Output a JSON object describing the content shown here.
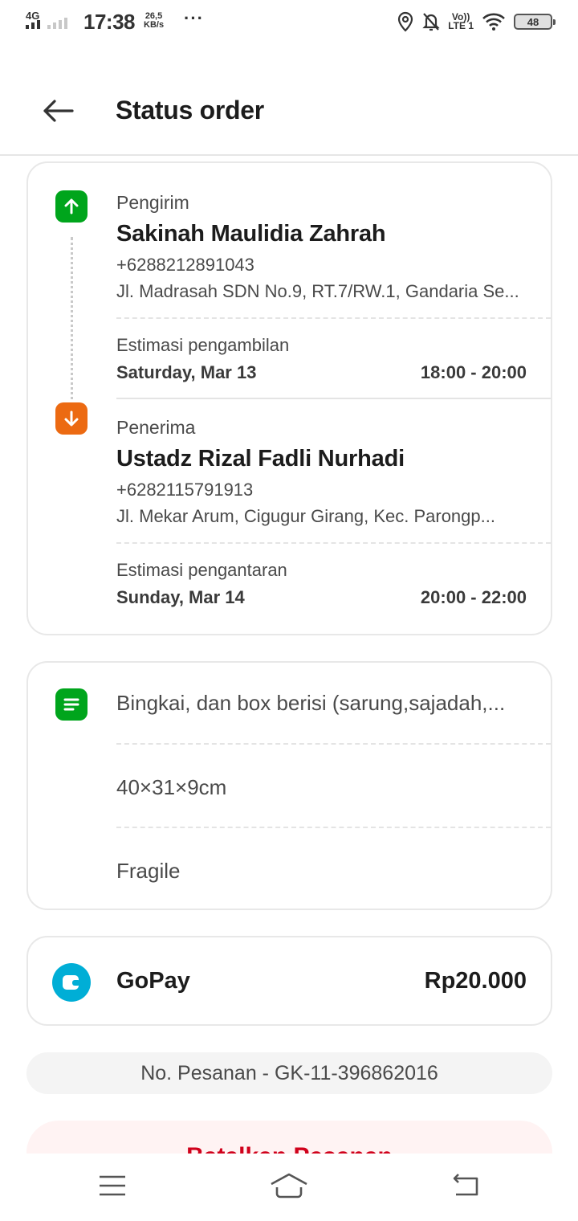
{
  "status_bar": {
    "network": "4G",
    "time": "17:38",
    "speed_value": "26,5",
    "speed_unit": "KB/s",
    "more": "···",
    "volte": "Vo))",
    "lte": "LTE 1",
    "battery": "48"
  },
  "header": {
    "title": "Status order"
  },
  "sender": {
    "label": "Pengirim",
    "name": "Sakinah Maulidia Zahrah",
    "phone": "+6288212891043",
    "address": "Jl. Madrasah SDN No.9, RT.7/RW.1, Gandaria Se...",
    "estimate_label": "Estimasi pengambilan",
    "estimate_date": "Saturday, Mar 13",
    "estimate_time": "18:00 - 20:00"
  },
  "receiver": {
    "label": "Penerima",
    "name": "Ustadz Rizal Fadli Nurhadi",
    "phone": "+6282115791913",
    "address": "Jl. Mekar Arum, Cigugur Girang, Kec. Parongp...",
    "estimate_label": "Estimasi pengantaran",
    "estimate_date": "Sunday, Mar 14",
    "estimate_time": "20:00 - 22:00"
  },
  "item": {
    "description": "Bingkai, dan box berisi (sarung,sajadah,...",
    "dimensions": "40×31×9cm",
    "note": "Fragile"
  },
  "payment": {
    "method": "GoPay",
    "amount": "Rp20.000"
  },
  "order_number": "No. Pesanan - GK-11-396862016",
  "cancel_button_label": "Batalkan Pesanan",
  "colors": {
    "green": "#00a51c",
    "orange": "#ec6a12",
    "gopay": "#00aed6",
    "cancel_text": "#d0011b"
  },
  "icons": [
    "signal-icon",
    "location-icon",
    "bell-off-icon",
    "wifi-icon",
    "battery-icon",
    "back-arrow-icon",
    "arrow-up-icon",
    "arrow-down-icon",
    "list-icon",
    "wallet-icon",
    "menu-icon",
    "home-icon",
    "return-icon"
  ]
}
